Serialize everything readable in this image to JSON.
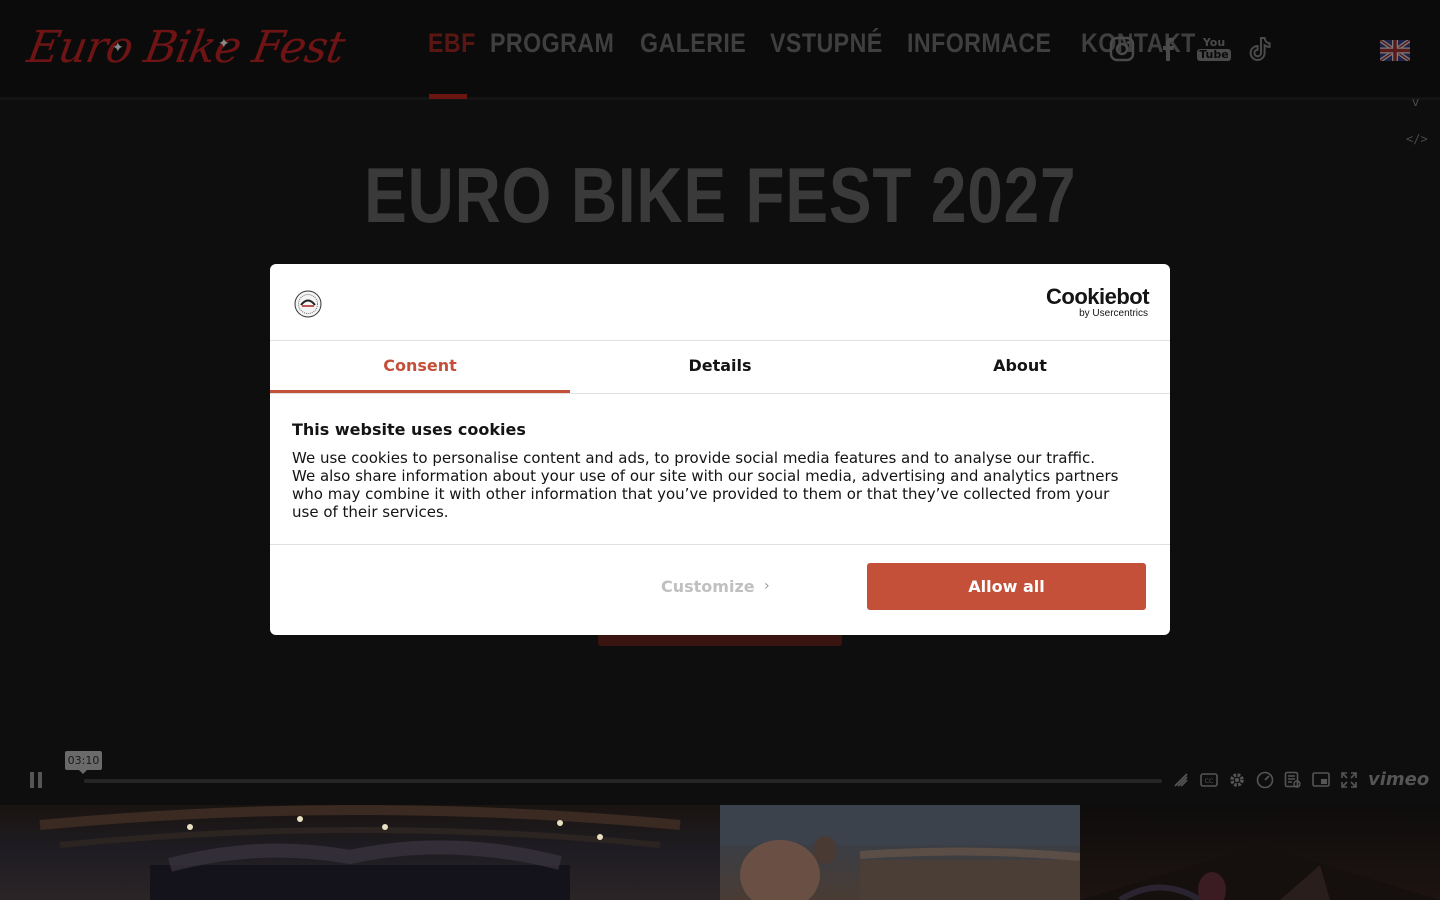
{
  "header": {
    "logo_text": "Euro Bike Fest",
    "nav": [
      "EBF",
      "PROGRAM",
      "GALERIE",
      "VSTUPNÉ",
      "INFORMACE",
      "KONTAKT"
    ],
    "active_nav": "EBF",
    "social": [
      "instagram-icon",
      "facebook-icon",
      "youtube-icon",
      "tiktok-icon"
    ],
    "youtube_label_top": "You",
    "youtube_label_bottom": "Tube",
    "language_flag": "uk-flag-icon",
    "side_v": "v",
    "side_code": "</>"
  },
  "hero": {
    "title": "EURO BIKE FEST 2027"
  },
  "video": {
    "time_tooltip": "03:10",
    "brand": "vimeo",
    "controls": [
      "hd-off-icon",
      "cc-icon",
      "settings-icon",
      "speed-icon",
      "transcript-icon",
      "pip-icon",
      "fullscreen-icon"
    ]
  },
  "cookie_dialog": {
    "brand_name": "Cookiebot",
    "brand_by": "by Usercentrics",
    "tabs": [
      "Consent",
      "Details",
      "About"
    ],
    "active_tab": "Consent",
    "heading": "This website uses cookies",
    "body": "We use cookies to personalise content and ads, to provide social media features and to analyse our traffic. We also share information about your use of our site with our social media, advertising and analytics partners who may combine it with other information that you’ve provided to them or that they’ve collected from your use of their services.",
    "customize_label": "Customize",
    "allow_all_label": "Allow all",
    "accent_color": "#c5503a"
  }
}
